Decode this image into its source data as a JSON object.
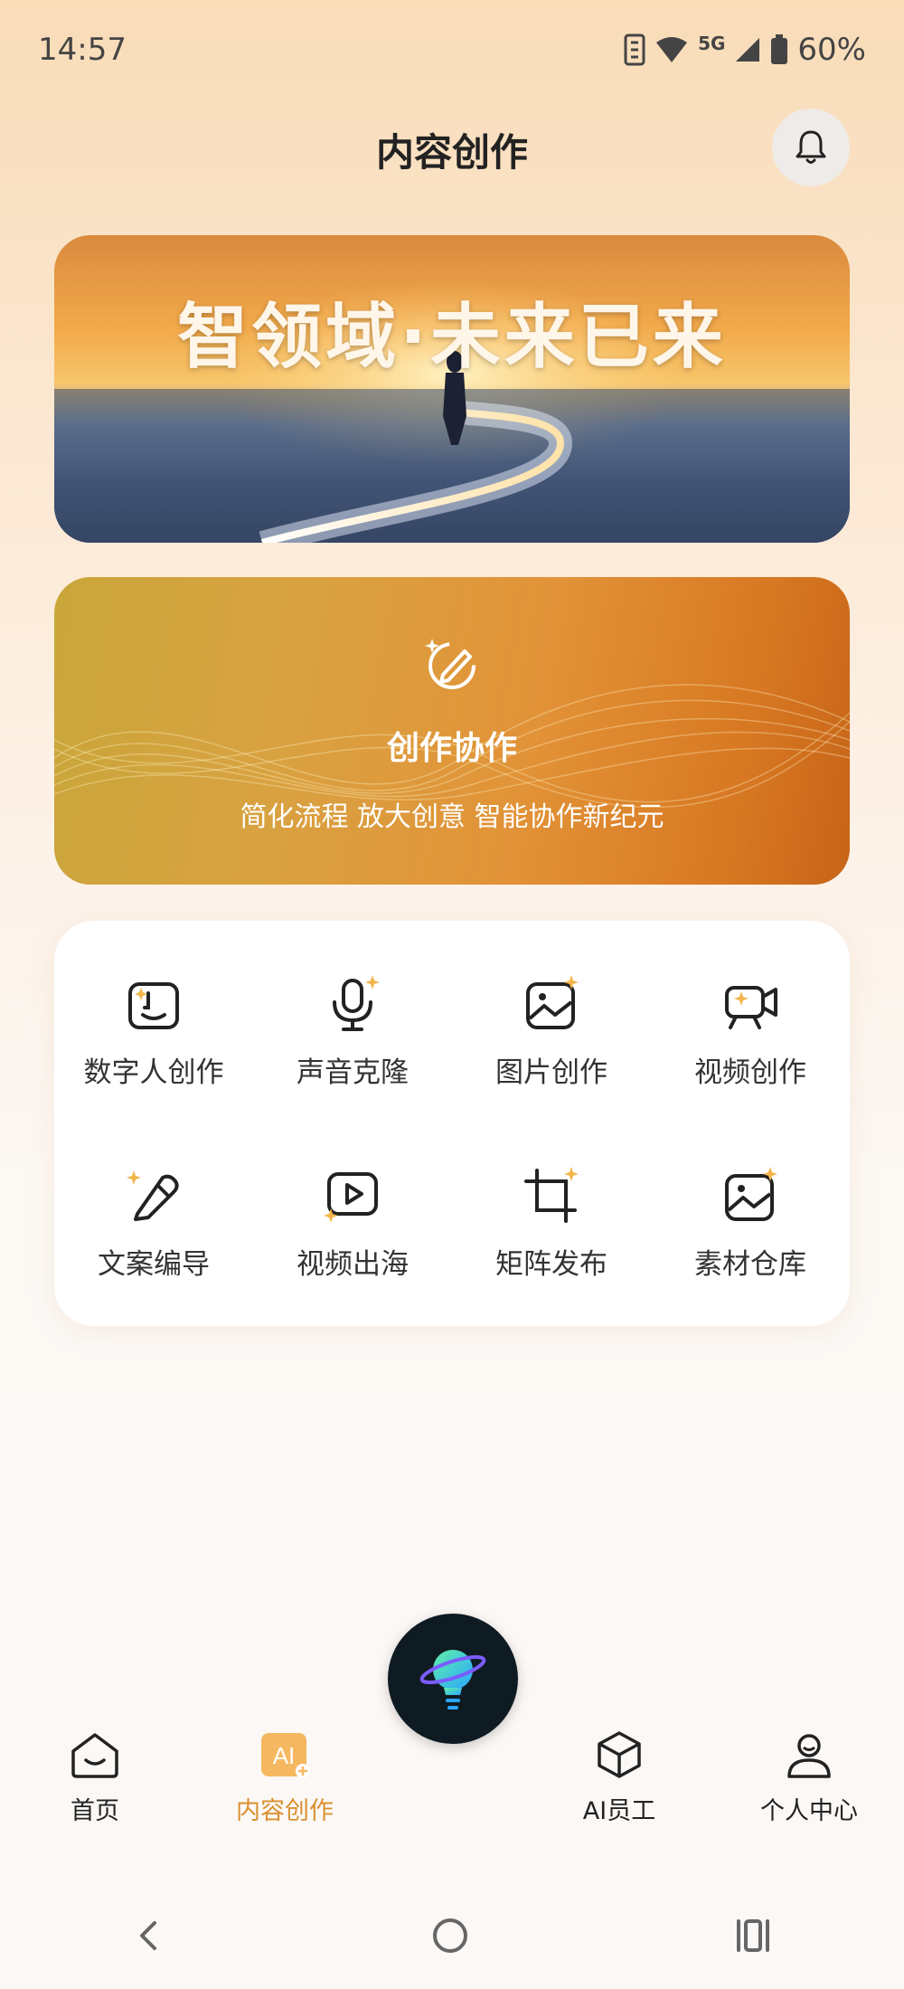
{
  "status": {
    "time": "14:57",
    "network": "5G",
    "battery": "60%"
  },
  "header": {
    "title": "内容创作"
  },
  "banner": {
    "headline": "智领域·未来已来"
  },
  "collab": {
    "title": "创作协作",
    "subtitle": "简化流程 放大创意 智能协作新纪元"
  },
  "features": [
    {
      "label": "数字人创作",
      "icon": "digital-human-icon"
    },
    {
      "label": "声音克隆",
      "icon": "microphone-icon"
    },
    {
      "label": "图片创作",
      "icon": "image-icon"
    },
    {
      "label": "视频创作",
      "icon": "video-camera-icon"
    },
    {
      "label": "文案编导",
      "icon": "pen-edit-icon"
    },
    {
      "label": "视频出海",
      "icon": "video-play-icon"
    },
    {
      "label": "矩阵发布",
      "icon": "crop-matrix-icon"
    },
    {
      "label": "素材仓库",
      "icon": "image-library-icon"
    }
  ],
  "tabs": [
    {
      "label": "首页",
      "icon": "home-icon"
    },
    {
      "label": "内容创作",
      "icon": "ai-create-icon",
      "active": true
    },
    {
      "label": "AI员工",
      "icon": "cube-icon"
    },
    {
      "label": "个人中心",
      "icon": "user-icon"
    }
  ],
  "colors": {
    "accent": "#d9902f",
    "sparkle": "#f3b54a"
  }
}
